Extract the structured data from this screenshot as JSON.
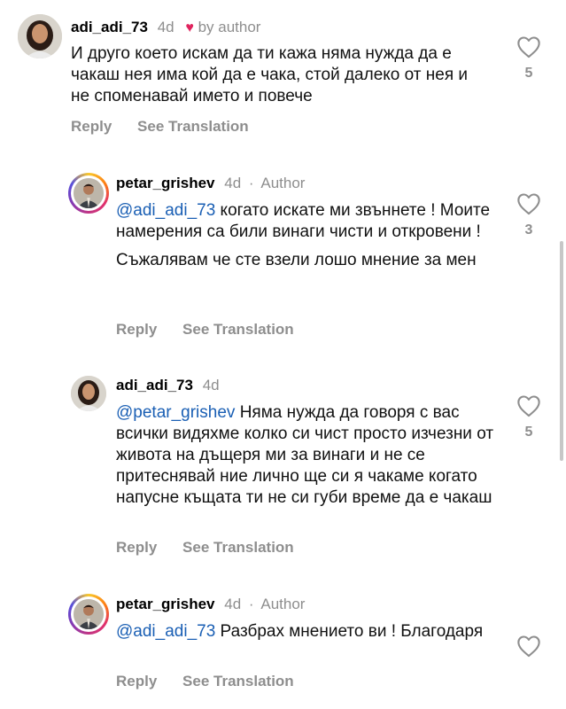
{
  "comments": [
    {
      "username": "adi_adi_73",
      "time": "4d",
      "liked_by": "by author",
      "text": "И друго което искам да ти кажа няма нужда да е чакаш нея има кой да е чака, стой далеко от нея и не споменавай името и повече",
      "reply": "Reply",
      "see_translation": "See Translation",
      "likes": "5"
    },
    {
      "username": "petar_grishev",
      "time": "4d",
      "author_tag": "Author",
      "mention": "@adi_adi_73",
      "text": "когато искате ми звъннете ! Моите намерения са били винаги чисти и откровени !",
      "text2": "Съжалявам че сте взели лошо мнение за мен",
      "reply": "Reply",
      "see_translation": "See Translation",
      "likes": "3"
    },
    {
      "username": "adi_adi_73",
      "time": "4d",
      "mention": "@petar_grishev",
      "text": "Няма нужда да говоря с вас всички видяхме колко си чист просто изчезни от живота на дъщеря ми за винаги и не се притеснявай ние лично ще си я чакаме когато напусне къщата ти не си губи време да е чакаш",
      "reply": "Reply",
      "see_translation": "See Translation",
      "likes": "5"
    },
    {
      "username": "petar_grishev",
      "time": "4d",
      "author_tag": "Author",
      "mention": "@adi_adi_73",
      "text": "Разбрах мнението ви ! Благодаря",
      "reply": "Reply",
      "see_translation": "See Translation"
    }
  ],
  "dot_separator": "·",
  "icons": {
    "like": "heart-outline-icon",
    "author_like": "heart-filled-icon"
  },
  "colors": {
    "mention": "#1a5fb4",
    "muted": "#8e8e8e",
    "heart_red": "#e0245e"
  }
}
